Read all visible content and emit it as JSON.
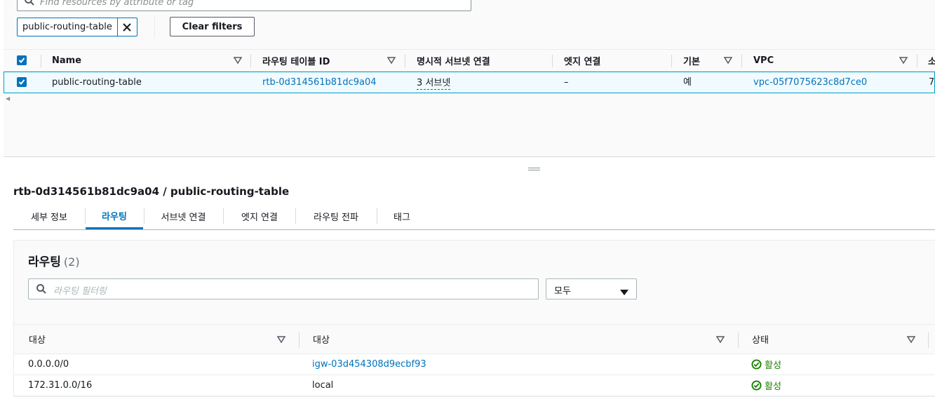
{
  "search": {
    "placeholder": "Find resources by attribute or tag"
  },
  "filter_chip": {
    "label": "public-routing-table"
  },
  "clear_filters_label": "Clear filters",
  "table": {
    "columns": [
      "Name",
      "라우팅 테이블 ID",
      "명시적 서브넷 연결",
      "엣지 연결",
      "기본",
      "VPC",
      "소"
    ],
    "rows": [
      {
        "name": "public-routing-table",
        "route_table_id": "rtb-0d314561b81dc9a04",
        "explicit_subnets": "3 서브넷",
        "edge_association": "–",
        "main": "예",
        "vpc": "vpc-05f7075623c8d7ce0",
        "owner_partial": "7"
      }
    ]
  },
  "detail": {
    "title": "rtb-0d314561b81dc9a04 / public-routing-table",
    "tabs": [
      "세부 정보",
      "라우팅",
      "서브넷 연결",
      "엣지 연결",
      "라우팅 전파",
      "태그"
    ],
    "active_tab": "라우팅"
  },
  "routes": {
    "title": "라우팅",
    "count": "(2)",
    "filter_placeholder": "라우팅 필터링",
    "select_value": "모두",
    "columns": [
      "대상",
      "대상",
      "상태"
    ],
    "rows": [
      {
        "destination": "0.0.0.0/0",
        "target": "igw-03d454308d9ecbf93",
        "target_is_link": true,
        "status": "활성"
      },
      {
        "destination": "172.31.0.0/16",
        "target": "local",
        "target_is_link": false,
        "status": "활성"
      }
    ]
  },
  "colors": {
    "link": "#0073bb",
    "active_status": "#1d8102",
    "selected_row_bg": "#f1faff"
  },
  "icons": [
    "search-icon",
    "close-icon",
    "checkbox-checked-icon",
    "sort-caret-icon",
    "caret-down-icon",
    "status-positive-icon",
    "resize-handle-icon"
  ]
}
